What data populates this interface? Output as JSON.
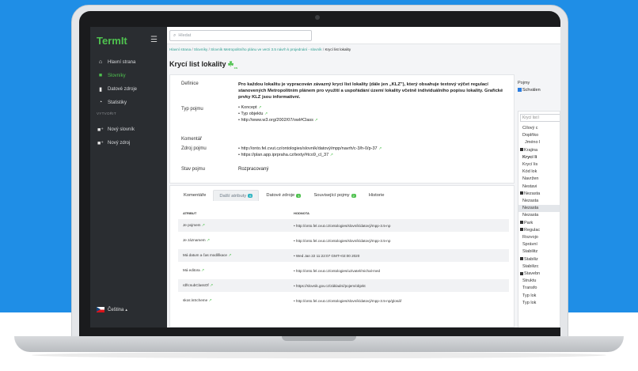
{
  "app": {
    "brand": "TermIt",
    "collapse_icon": "collapse-menu-icon"
  },
  "sidebar": {
    "items": [
      {
        "label": "Hlavní strana",
        "icon": "home-icon"
      },
      {
        "label": "Slovníky",
        "icon": "book-icon"
      },
      {
        "label": "Datové zdroje",
        "icon": "file-icon"
      },
      {
        "label": "Statistiky",
        "icon": "chart-icon"
      }
    ],
    "section": "VYTVOŘIT",
    "create": [
      {
        "label": "Nový slovník",
        "icon": "add-book-icon"
      },
      {
        "label": "Nový zdroj",
        "icon": "add-file-icon"
      }
    ],
    "language": "Čeština"
  },
  "search": {
    "placeholder": "Hledat"
  },
  "breadcrumb": {
    "home": "Hlavní strana",
    "vocabs": "Slovníky",
    "vocab": "Slovník Metropolitního plánu ve verzi 3.5 návrh k projednání - slovník",
    "current": "Krycí list lokality"
  },
  "term": {
    "title": "Krycí list lokality",
    "lang_sub": "cs",
    "labels": {
      "definition": "Definice",
      "type": "Typ pojmu",
      "comment": "Komentář",
      "source": "Zdroj pojmu",
      "state": "Stav pojmu"
    },
    "definition": "Pro každou lokalitu je vypracován závazný krycí list lokality (dále jen „KLZ\"), který obsahuje textový výčet regulací stanovených Metropolitním plánem pro využití a uspořádání území lokality včetně individuálního popisu lokality. Grafické prvky KLZ jsou informativní.",
    "types": [
      "Koncept",
      "Typ objektu",
      "http://www.w3.org/2002/07/owl#Class"
    ],
    "sources": [
      "http://onto.fel.cvut.cz/ontologies/slovník/datový/mpp/navrh/c-3/h-0/p-37",
      "https://plan.app.iprpraha.cz/texty/#tco9_cl_37"
    ],
    "state": "Rozpracovaný"
  },
  "tabs": [
    {
      "label": "Komentáře",
      "badge": ""
    },
    {
      "label": "Další atributy",
      "badge": "6"
    },
    {
      "label": "Datové zdroje",
      "badge": "1"
    },
    {
      "label": "Související pojmy",
      "badge": "2"
    },
    {
      "label": "Historie",
      "badge": ""
    }
  ],
  "table": {
    "headers": [
      "ATRIBUT",
      "HODNOTA"
    ],
    "rows": [
      {
        "attr": "Je pojmem",
        "value": "http://onto.fel.cvut.cz/ontologies/slovník/datový/mpp-3.5-np"
      },
      {
        "attr": "Je záznamem",
        "value": "http://onto.fel.cvut.cz/ontologies/slovník/datový/mpp-3.5-np"
      },
      {
        "attr": "Má datum a čas modifikace",
        "value": "Wed Jan 22 11:22:07 GMT+02:00 2020"
      },
      {
        "attr": "Má editora",
        "value": "http://onto.fel.cvut.cz/ontologies/uzivatel/michal-med"
      },
      {
        "attr": "rdfs:subClassOf",
        "value": "https://slovnik.gov.cz/základní/pojem/objekt"
      },
      {
        "attr": "skos:inScheme",
        "value": "http://onto.fel.cvut.cz/ontologies/slovník/datový/mpp-3.5-np/glosář"
      }
    ]
  },
  "right_panel": {
    "label": "Pojmy",
    "checkbox": "Schválen",
    "tree_search": "Krycí list l",
    "items": [
      {
        "label": "Cílový c",
        "bold": false,
        "plus": false,
        "sel": false,
        "indent": 1
      },
      {
        "label": "Doplňko",
        "bold": false,
        "plus": false,
        "sel": false,
        "indent": 1
      },
      {
        "label": "Jméno l",
        "bold": false,
        "plus": false,
        "sel": false,
        "indent": 2
      },
      {
        "label": "Krajina",
        "bold": false,
        "plus": true,
        "sel": false,
        "indent": 0
      },
      {
        "label": "Krycí li",
        "bold": true,
        "plus": false,
        "sel": false,
        "indent": 1
      },
      {
        "label": "Krycí lis",
        "bold": false,
        "plus": false,
        "sel": false,
        "indent": 1
      },
      {
        "label": "Kód lok",
        "bold": false,
        "plus": false,
        "sel": false,
        "indent": 1
      },
      {
        "label": "Navržen",
        "bold": false,
        "plus": false,
        "sel": false,
        "indent": 1
      },
      {
        "label": "Nestavi",
        "bold": false,
        "plus": false,
        "sel": false,
        "indent": 1
      },
      {
        "label": "Nezasta",
        "bold": false,
        "plus": true,
        "sel": false,
        "indent": 0
      },
      {
        "label": "Nezasta",
        "bold": false,
        "plus": false,
        "sel": false,
        "indent": 1
      },
      {
        "label": "Nezasta",
        "bold": false,
        "plus": false,
        "sel": true,
        "indent": 1
      },
      {
        "label": "Nezasta",
        "bold": false,
        "plus": false,
        "sel": false,
        "indent": 1
      },
      {
        "label": "Park",
        "bold": false,
        "plus": true,
        "sel": false,
        "indent": 0
      },
      {
        "label": "Regulac",
        "bold": false,
        "plus": true,
        "sel": false,
        "indent": 0
      },
      {
        "label": "Rozvojo",
        "bold": false,
        "plus": false,
        "sel": false,
        "indent": 1
      },
      {
        "label": "Správní",
        "bold": false,
        "plus": false,
        "sel": false,
        "indent": 1
      },
      {
        "label": "Stabilitz",
        "bold": false,
        "plus": false,
        "sel": false,
        "indent": 1
      },
      {
        "label": "Stabiliz",
        "bold": false,
        "plus": true,
        "sel": false,
        "indent": 0
      },
      {
        "label": "Stabilizc",
        "bold": false,
        "plus": false,
        "sel": false,
        "indent": 1
      },
      {
        "label": "Stavebn",
        "bold": false,
        "plus": true,
        "sel": false,
        "indent": 0
      },
      {
        "label": "Struktu",
        "bold": false,
        "plus": false,
        "sel": false,
        "indent": 1
      },
      {
        "label": "Transfo",
        "bold": false,
        "plus": false,
        "sel": false,
        "indent": 1
      },
      {
        "label": "Typ lok",
        "bold": false,
        "plus": false,
        "sel": false,
        "indent": 1
      },
      {
        "label": "Typ lok",
        "bold": false,
        "plus": false,
        "sel": false,
        "indent": 1
      }
    ]
  },
  "colors": {
    "background": "#1f8ee6",
    "accent": "#4fc24f",
    "sidebar": "#2a2d31"
  }
}
